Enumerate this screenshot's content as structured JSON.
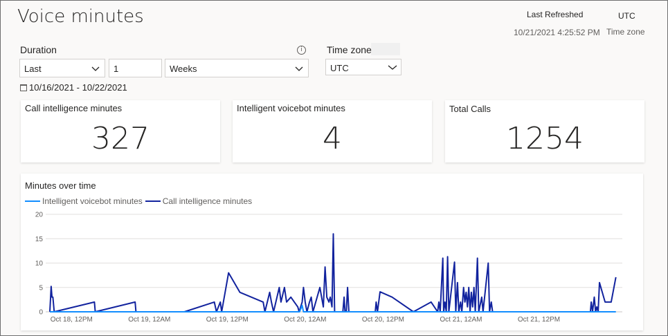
{
  "page": {
    "title": "Voice minutes",
    "last_refreshed_label": "Last Refreshed",
    "last_refreshed_value": "10/21/2021 4:25:52 PM",
    "timezone_value": "UTC",
    "timezone_caption": "Time zone"
  },
  "filters": {
    "duration_label": "Duration",
    "info_icon": "info-icon",
    "period_mode": "Last",
    "period_count": "1",
    "period_unit": "Weeks",
    "timezone_label": "Time zone",
    "timezone_selected": "UTC",
    "date_range": "10/16/2021 - 10/22/2021",
    "calendar_icon": "calendar-icon"
  },
  "cards": [
    {
      "label": "Call intelligence minutes",
      "value": "327"
    },
    {
      "label": "Intelligent voicebot minutes",
      "value": "4"
    },
    {
      "label": "Total Calls",
      "value": "1254"
    }
  ],
  "chart": {
    "title": "Minutes over time",
    "legend": [
      "Intelligent voicebot minutes",
      "Call intelligence minutes"
    ]
  },
  "colors": {
    "voicebot": "#118dff",
    "call_intelligence": "#12239e",
    "grid": "#e1dfdd"
  },
  "chart_data": {
    "type": "line",
    "title": "Minutes over time",
    "xlabel": "",
    "ylabel": "",
    "ylim": [
      0,
      20
    ],
    "yticks": [
      0,
      5,
      10,
      15,
      20
    ],
    "xlim_hours": [
      0,
      131
    ],
    "x_ticks": [
      {
        "label": "Oct 18, 12PM",
        "h": 5
      },
      {
        "label": "Oct 19, 12AM",
        "h": 23
      },
      {
        "label": "Oct 19, 12PM",
        "h": 41
      },
      {
        "label": "Oct 20, 12AM",
        "h": 59
      },
      {
        "label": "Oct 20, 12PM",
        "h": 77
      },
      {
        "label": "Oct 21, 12AM",
        "h": 95
      },
      {
        "label": "Oct 21, 12PM",
        "h": 113
      }
    ],
    "legend_position": "top-left",
    "series": [
      {
        "name": "Call intelligence minutes",
        "points": [
          [
            0,
            0
          ],
          [
            0.3,
            5.2
          ],
          [
            0.5,
            3
          ],
          [
            0.7,
            3
          ],
          [
            1,
            0
          ],
          [
            10.3,
            2
          ],
          [
            10.5,
            0
          ],
          [
            19.7,
            2
          ],
          [
            19.9,
            0
          ],
          [
            31.1,
            0
          ],
          [
            38,
            2
          ],
          [
            38.5,
            0
          ],
          [
            39.4,
            2
          ],
          [
            39.7,
            0
          ],
          [
            41.3,
            8
          ],
          [
            43.9,
            4
          ],
          [
            49.3,
            2
          ],
          [
            49.7,
            0
          ],
          [
            50.8,
            4
          ],
          [
            51.2,
            2
          ],
          [
            51.7,
            0
          ],
          [
            53,
            5
          ],
          [
            53.4,
            2
          ],
          [
            54.2,
            5
          ],
          [
            54.7,
            2
          ],
          [
            55.7,
            3
          ],
          [
            56.5,
            2
          ],
          [
            57.3,
            1
          ],
          [
            57.6,
            0
          ],
          [
            58.3,
            2
          ],
          [
            58.6,
            5
          ],
          [
            59,
            2
          ],
          [
            59.4,
            0
          ],
          [
            60,
            2
          ],
          [
            60.4,
            3
          ],
          [
            60.8,
            0
          ],
          [
            62.4,
            5
          ],
          [
            62.8,
            3
          ],
          [
            63.2,
            1
          ],
          [
            63.6,
            9.2
          ],
          [
            64,
            3
          ],
          [
            64.5,
            2
          ],
          [
            64.8,
            3
          ],
          [
            65.2,
            1
          ],
          [
            65.5,
            16
          ],
          [
            65.8,
            0
          ],
          [
            67.7,
            0
          ],
          [
            68,
            3
          ],
          [
            68.2,
            0
          ],
          [
            68.5,
            0
          ],
          [
            68.8,
            5
          ],
          [
            69.1,
            0
          ],
          [
            75.2,
            0
          ],
          [
            75.4,
            2
          ],
          [
            75.7,
            0
          ],
          [
            76.3,
            4.1
          ],
          [
            79.1,
            3
          ],
          [
            84,
            0
          ],
          [
            88.1,
            2
          ],
          [
            89.6,
            0
          ],
          [
            89.9,
            2
          ],
          [
            90.2,
            0
          ],
          [
            90.8,
            11
          ],
          [
            91,
            0
          ],
          [
            91.3,
            2
          ],
          [
            91.6,
            0
          ],
          [
            91.9,
            11.3
          ],
          [
            92.2,
            0
          ],
          [
            93.5,
            10.2
          ],
          [
            93.8,
            0
          ],
          [
            94.2,
            6
          ],
          [
            94.5,
            0
          ],
          [
            94.9,
            2
          ],
          [
            95.2,
            0
          ],
          [
            95.6,
            5
          ],
          [
            95.9,
            2
          ],
          [
            96.2,
            4
          ],
          [
            96.5,
            1
          ],
          [
            96.8,
            5
          ],
          [
            97.1,
            0
          ],
          [
            97.4,
            4
          ],
          [
            97.7,
            1
          ],
          [
            98,
            5
          ],
          [
            98.3,
            0
          ],
          [
            98.8,
            11
          ],
          [
            99.1,
            0
          ],
          [
            99.8,
            3
          ],
          [
            100.1,
            0
          ],
          [
            101.3,
            10
          ],
          [
            101.6,
            0
          ],
          [
            102,
            2
          ],
          [
            102.3,
            0
          ],
          [
            124.9,
            0
          ],
          [
            125.1,
            2
          ],
          [
            125.4,
            0
          ],
          [
            125.8,
            3
          ],
          [
            126.1,
            0
          ],
          [
            126.4,
            1
          ],
          [
            126.7,
            0
          ],
          [
            127,
            6
          ],
          [
            128.3,
            2
          ],
          [
            129.7,
            2
          ],
          [
            130.8,
            7.1
          ]
        ]
      },
      {
        "name": "Intelligent voicebot minutes",
        "points": [
          [
            0,
            0
          ],
          [
            57.7,
            0
          ],
          [
            58.3,
            1.3
          ],
          [
            58.6,
            0
          ],
          [
            130.8,
            0
          ]
        ]
      }
    ]
  }
}
